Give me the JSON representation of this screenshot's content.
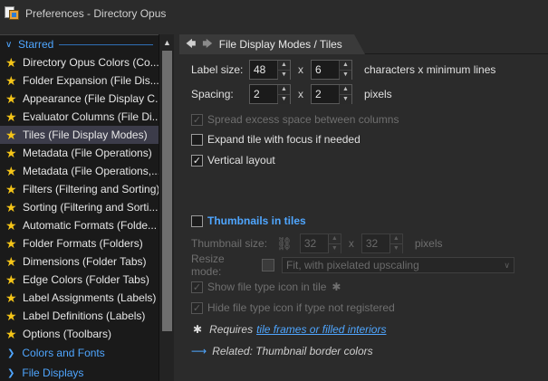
{
  "window": {
    "title": "Preferences - Directory Opus"
  },
  "sidebar": {
    "section": "Starred",
    "items": [
      {
        "label": "Directory Opus Colors (Co..."
      },
      {
        "label": "Folder Expansion (File Dis..."
      },
      {
        "label": "Appearance (File Display C..."
      },
      {
        "label": "Evaluator Columns (File Di..."
      },
      {
        "label": "Tiles (File Display Modes)",
        "selected": true
      },
      {
        "label": "Metadata (File Operations)"
      },
      {
        "label": "Metadata (File Operations,..."
      },
      {
        "label": "Filters (Filtering and Sorting)"
      },
      {
        "label": "Sorting (Filtering and Sorti..."
      },
      {
        "label": "Automatic Formats (Folde..."
      },
      {
        "label": "Folder Formats (Folders)"
      },
      {
        "label": "Dimensions (Folder Tabs)"
      },
      {
        "label": "Edge Colors (Folder Tabs)"
      },
      {
        "label": "Label Assignments (Labels)"
      },
      {
        "label": "Label Definitions (Labels)"
      },
      {
        "label": "Options (Toolbars)"
      }
    ],
    "subsections": [
      {
        "label": "Colors and Fonts"
      },
      {
        "label": "File Displays"
      }
    ]
  },
  "breadcrumb": {
    "text": "File Display Modes / Tiles"
  },
  "form": {
    "label_size": {
      "label": "Label size:",
      "width": "48",
      "sep": "x",
      "lines": "6",
      "suffix": "characters x minimum lines"
    },
    "spacing": {
      "label": "Spacing:",
      "x": "2",
      "sep": "x",
      "y": "2",
      "suffix": "pixels"
    },
    "spread": {
      "label": "Spread excess space between columns",
      "checked": true,
      "enabled": false
    },
    "expand": {
      "label": "Expand tile with focus if needed",
      "checked": false
    },
    "vertical": {
      "label": "Vertical layout",
      "checked": true
    },
    "thumbnails": {
      "label": "Thumbnails in tiles",
      "checked": false
    },
    "thumb_size": {
      "label": "Thumbnail size:",
      "w": "32",
      "sep": "x",
      "h": "32",
      "suffix": "pixels"
    },
    "resize": {
      "label": "Resize mode:",
      "value": "Fit, with pixelated upscaling"
    },
    "show_icon": {
      "label": "Show file type icon in tile",
      "checked": true,
      "enabled": false
    },
    "hide_icon": {
      "label": "Hide file type icon if type not registered",
      "checked": true,
      "enabled": false
    },
    "requires": {
      "prefix": "Requires",
      "link": "tile frames or filled interiors"
    },
    "related": {
      "text": "Related: Thumbnail border colors"
    }
  }
}
